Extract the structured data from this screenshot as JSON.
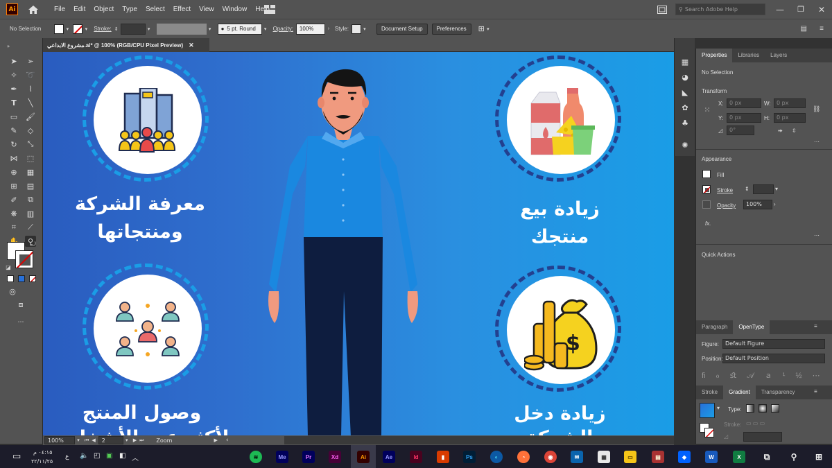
{
  "menubar": {
    "app_logo": "Ai",
    "items": [
      "File",
      "Edit",
      "Object",
      "Type",
      "Select",
      "Effect",
      "View",
      "Window",
      "Help"
    ],
    "search_placeholder": "Search Adobe Help"
  },
  "control": {
    "selection": "No Selection",
    "stroke_label": "Stroke:",
    "brush": "5 pt. Round",
    "opacity_label": "Opacity:",
    "opacity": "100%",
    "style_label": "Style:",
    "doc_setup": "Document Setup",
    "preferences": "Preferences"
  },
  "document": {
    "tab_title": "مشروع الابداعي.ai* @ 100% (RGB/CPU Pixel Preview)",
    "zoom": "100%",
    "artboard": "2",
    "status_tool": "Zoom"
  },
  "artwork": {
    "title_tl": "معرفة الشركة",
    "title_tl2": "ومنتجاتها",
    "title_tr": "زيادة بيع",
    "title_tr2": "منتجك",
    "title_bl": "وصول المنتج",
    "title_bl2": "لأكثر عدد الأشخاص",
    "title_br": "زيادة دخل",
    "title_br2": "الشركة"
  },
  "panel": {
    "tabs": [
      "Properties",
      "Libraries",
      "Layers"
    ],
    "no_selection": "No Selection",
    "transform": "Transform",
    "x_label": "X:",
    "x_val": "0 px",
    "y_label": "Y:",
    "y_val": "0 px",
    "w_label": "W:",
    "w_val": "0 px",
    "h_label": "H:",
    "h_val": "0 px",
    "angle": "0°",
    "appearance": "Appearance",
    "fill": "Fill",
    "stroke": "Stroke",
    "opacity": "Opacity",
    "opacity_val": "100%",
    "fx": "fx.",
    "quick_actions": "Quick Actions",
    "tabs2": [
      "Paragraph",
      "OpenType"
    ],
    "figure_label": "Figure:",
    "figure_val": "Default Figure",
    "position_label": "Position:",
    "position_val": "Default Position",
    "tabs3": [
      "Stroke",
      "Gradient",
      "Transparency"
    ],
    "type_label": "Type:",
    "stroke_label": "Stroke:"
  },
  "taskbar": {
    "time": "٠٤:١٥ م",
    "date": "٢٢/١١/٢٥",
    "lang": "ع",
    "apps": [
      "Me",
      "Pr",
      "Xd",
      "Ai",
      "Ae",
      "Id",
      "Ps"
    ]
  }
}
